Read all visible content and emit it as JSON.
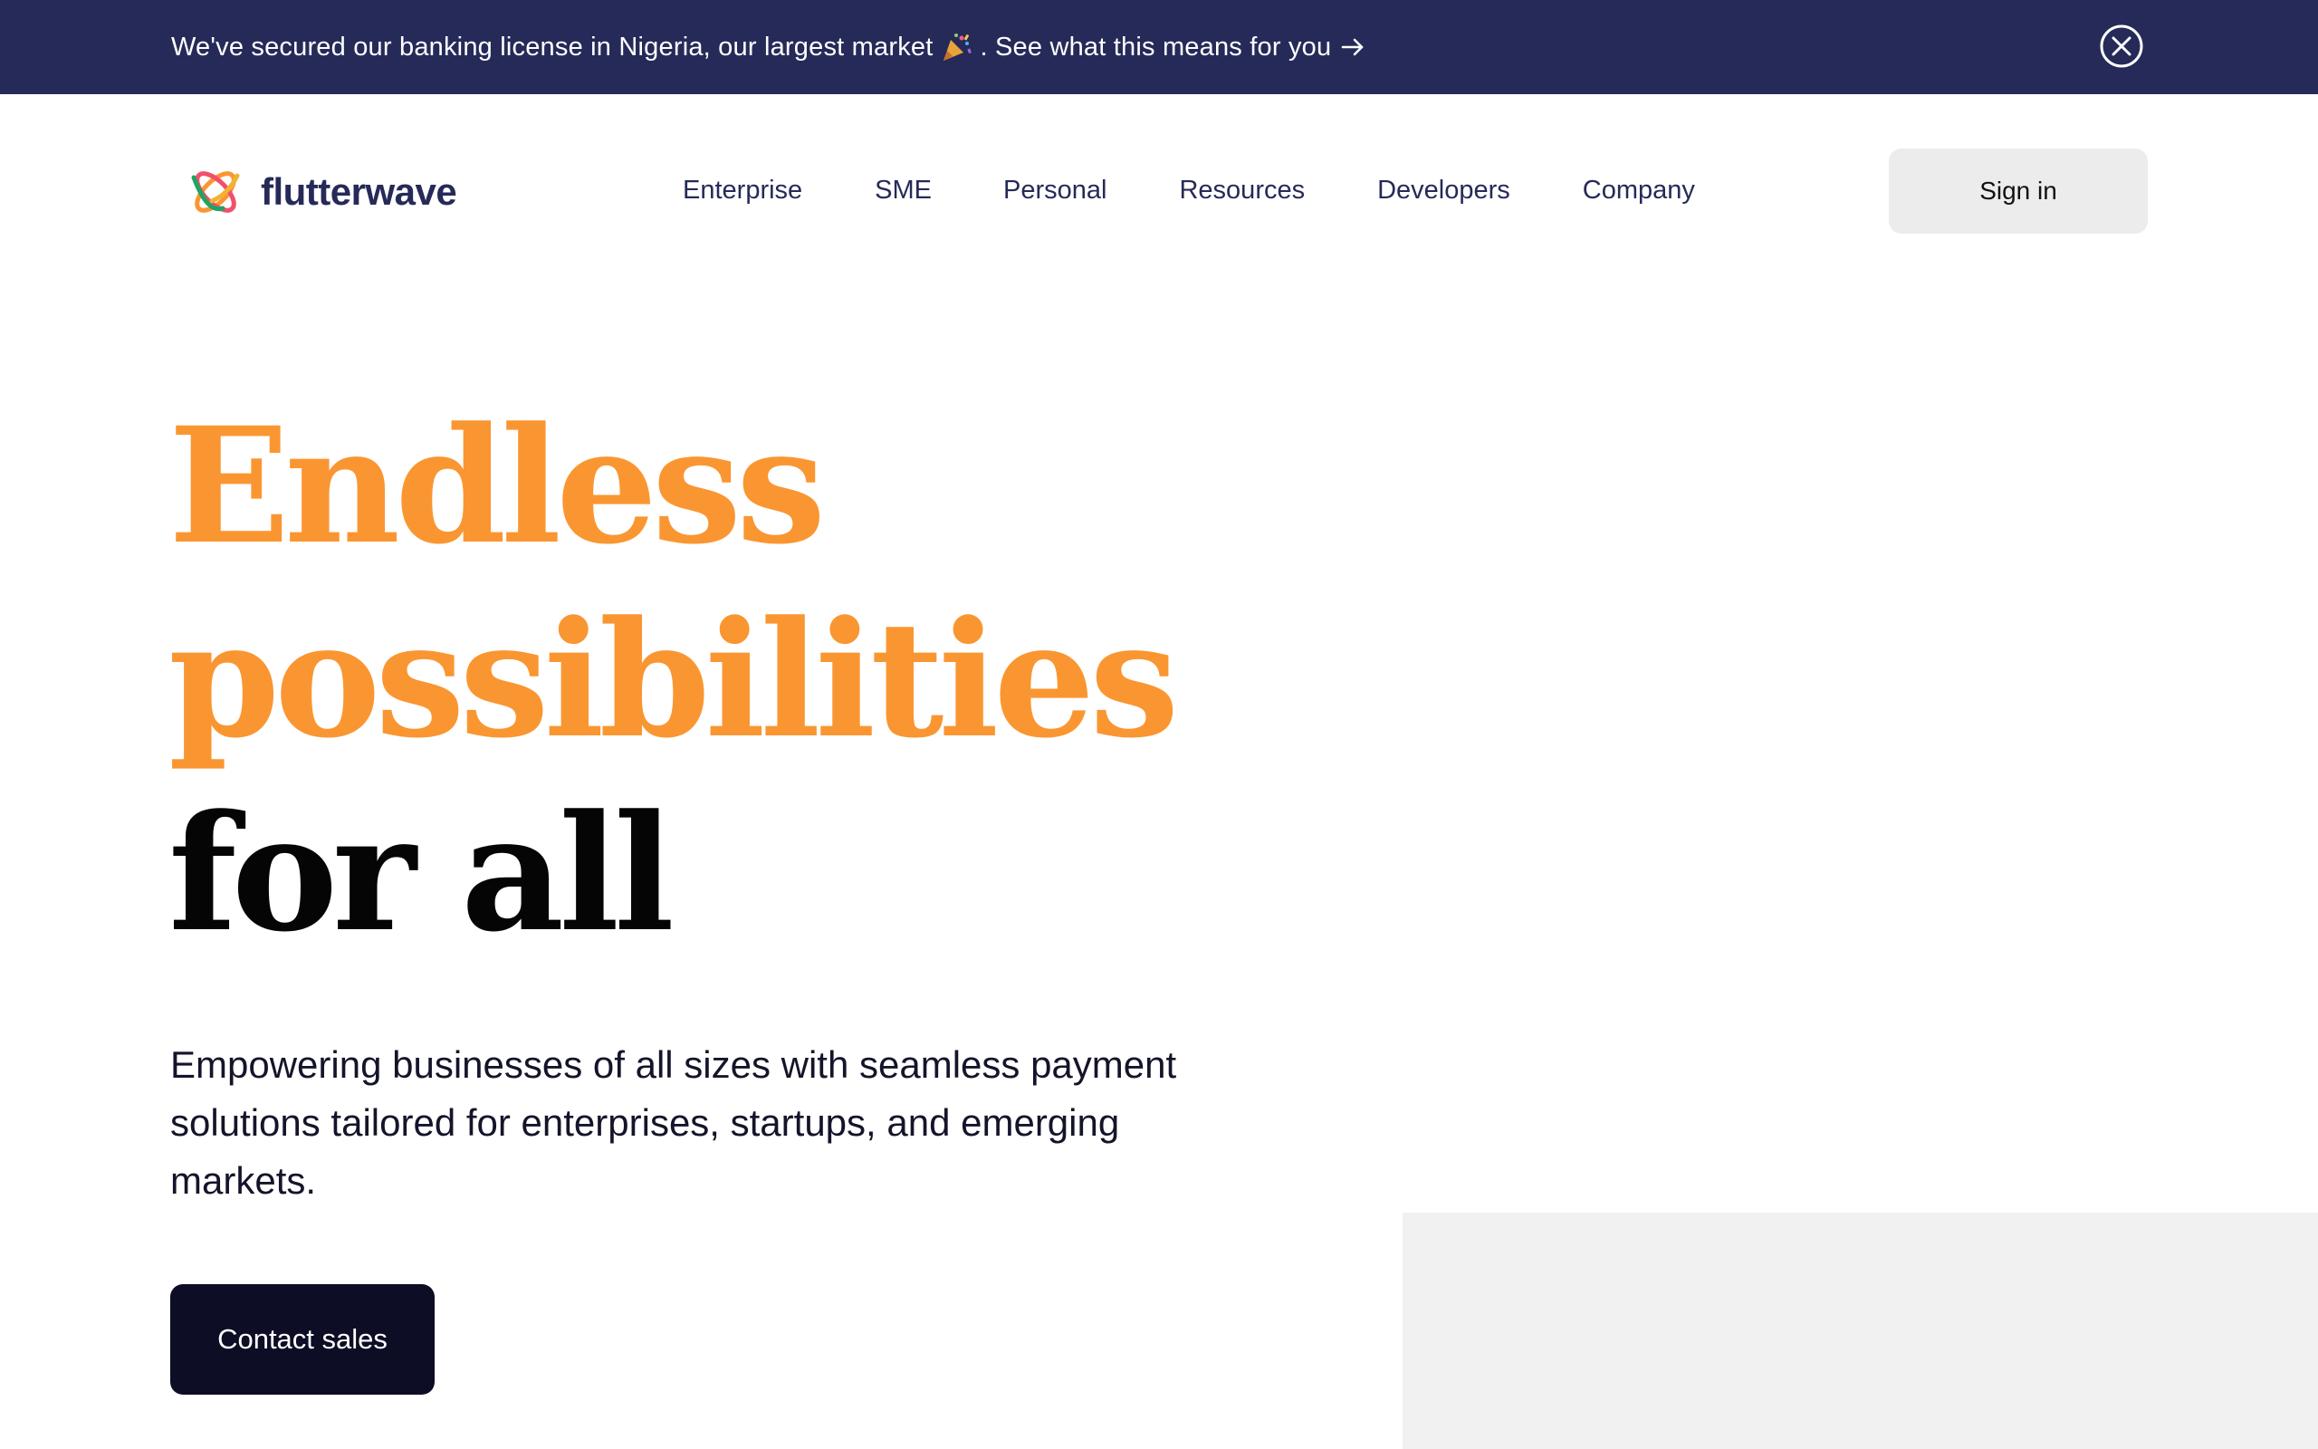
{
  "announcement": {
    "text_before": "We've secured our banking license in Nigeria, our largest market",
    "text_after": ". See what this means for you",
    "party_icon": "party-popper-icon",
    "arrow_icon": "arrow-right-icon",
    "close_icon": "close-circle-icon",
    "background": "#262a58"
  },
  "header": {
    "logo_text": "flutterwave",
    "nav": [
      "Enterprise",
      "SME",
      "Personal",
      "Resources",
      "Developers",
      "Company"
    ],
    "signin_label": "Sign in"
  },
  "hero": {
    "title_line1": "Endless",
    "title_line2": "possibilities",
    "title_line3": "for all",
    "subtitle": "Empowering businesses of all sizes with seamless payment solutions tailored for enterprises, startups, and emerging markets.",
    "cta_label": "Contact sales",
    "accent_color": "#fa9631",
    "cta_color": "#0d0d25"
  }
}
